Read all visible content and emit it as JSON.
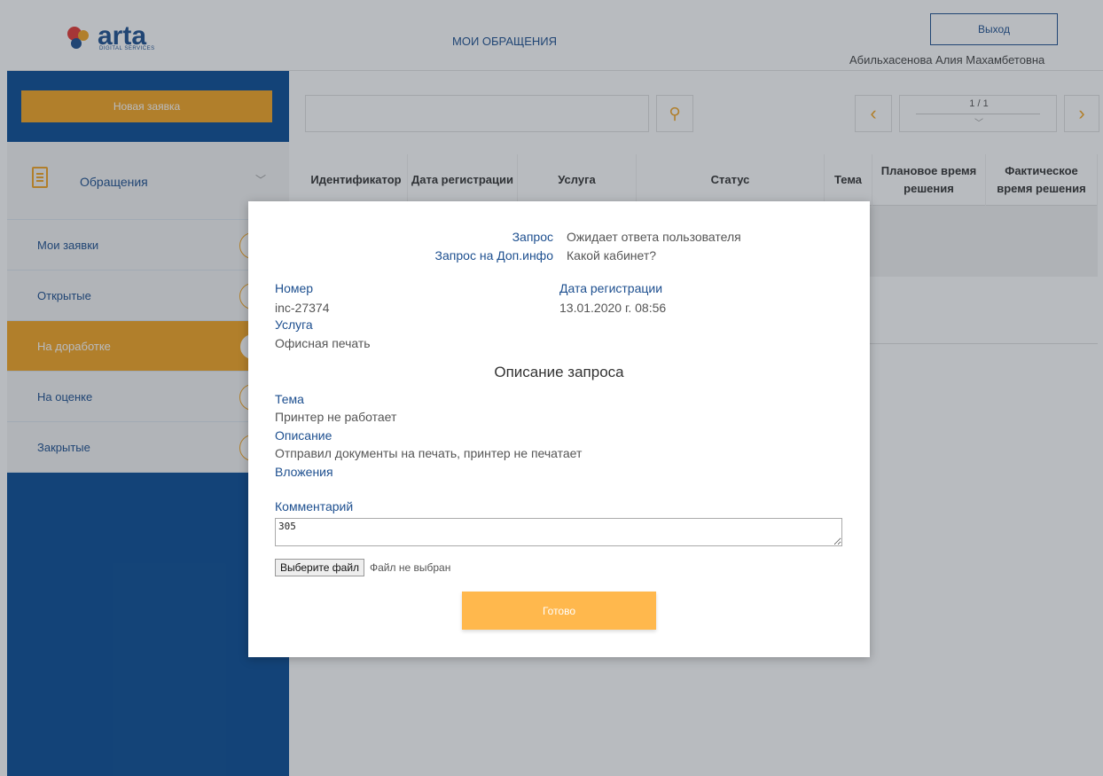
{
  "header": {
    "logo_text": "arta",
    "logo_sub": "DIGITAL SERVICES",
    "nav_title": "МОИ ОБРАЩЕНИЯ",
    "logout_label": "Выход",
    "user_name": "Абильхасенова Алия Махамбетовна"
  },
  "sidebar": {
    "new_request_label": "Новая заявка",
    "section_label": "Обращения",
    "items": [
      {
        "label": "Мои заявки"
      },
      {
        "label": "Открытые"
      },
      {
        "label": "На доработке"
      },
      {
        "label": "На оценке"
      },
      {
        "label": "Закрытые"
      }
    ]
  },
  "pagination": {
    "text": "1 / 1"
  },
  "table": {
    "columns": [
      {
        "label": "Идентификатор"
      },
      {
        "label": "Дата регистрации"
      },
      {
        "label": "Услуга"
      },
      {
        "label": "Статус"
      },
      {
        "label": "Тема"
      },
      {
        "label": "Плановое время решения"
      },
      {
        "label": "Фактическое время решения"
      }
    ]
  },
  "modal": {
    "request_label": "Запрос",
    "request_value": "Ожидает ответа пользователя",
    "info_label": "Запрос на Доп.инфо",
    "info_value": "Какой кабинет?",
    "number_label": "Номер",
    "number_value": "inc-27374",
    "date_label": "Дата регистрации",
    "date_value": "13.01.2020 г. 08:56",
    "service_label": "Услуга",
    "service_value": "Офисная печать",
    "section_title": "Описание запроса",
    "topic_label": "Тема",
    "topic_value": "Принтер не работает",
    "desc_label": "Описание",
    "desc_value": "Отправил документы на печать, принтер не печатает",
    "attachments_label": "Вложения",
    "comment_label": "Комментарий",
    "comment_value": "305",
    "file_button_label": "Выберите файл",
    "file_status": "Файл не выбран",
    "done_label": "Готово"
  },
  "colors": {
    "brand_blue": "#0a4d96",
    "accent_orange": "#f5a623",
    "link_blue": "#1d4f8f"
  },
  "icons": [
    "search-icon",
    "chevron-left-icon",
    "chevron-right-icon",
    "chevron-down-icon",
    "document-icon",
    "logo-icon"
  ]
}
